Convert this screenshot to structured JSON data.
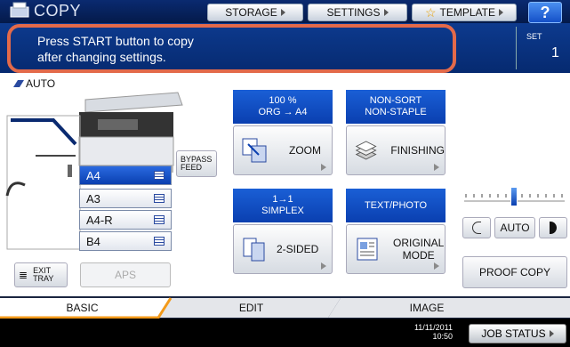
{
  "app": {
    "title": "COPY"
  },
  "top_buttons": {
    "storage": "STORAGE",
    "settings": "SETTINGS",
    "template": "TEMPLATE",
    "help": "?"
  },
  "message": {
    "line1": "Press START button to copy",
    "line2": "after changing settings."
  },
  "set": {
    "label": "SET",
    "value": "1"
  },
  "paper": {
    "auto_label": "AUTO",
    "bypass": "BYPASS\nFEED",
    "sizes": [
      "A4",
      "A3",
      "A4-R",
      "B4"
    ],
    "selected": "A4",
    "exit_tray": "EXIT\nTRAY",
    "aps": "APS"
  },
  "zoom": {
    "header_line1": "100 %",
    "header_line2": "ORG → A4",
    "button": "ZOOM"
  },
  "finishing": {
    "header_line1": "NON-SORT",
    "header_line2": "NON-STAPLE",
    "button": "FINISHING"
  },
  "sided": {
    "header_line1": "1→1",
    "header_line2": "SIMPLEX",
    "button": "2-SIDED"
  },
  "original": {
    "header": "TEXT/PHOTO",
    "button_line1": "ORIGINAL",
    "button_line2": "MODE"
  },
  "density": {
    "auto": "AUTO",
    "level": 0.5
  },
  "proof": "PROOF COPY",
  "tabs": [
    "BASIC",
    "EDIT",
    "IMAGE"
  ],
  "status": {
    "date": "11/11/2011",
    "time": "10:50",
    "job_status": "JOB STATUS"
  },
  "colors": {
    "top_bar": "#0a2a70",
    "highlight": "#e36a4a",
    "header_blue": "#1a5fd6",
    "selected_tab": "#f39a1a"
  }
}
